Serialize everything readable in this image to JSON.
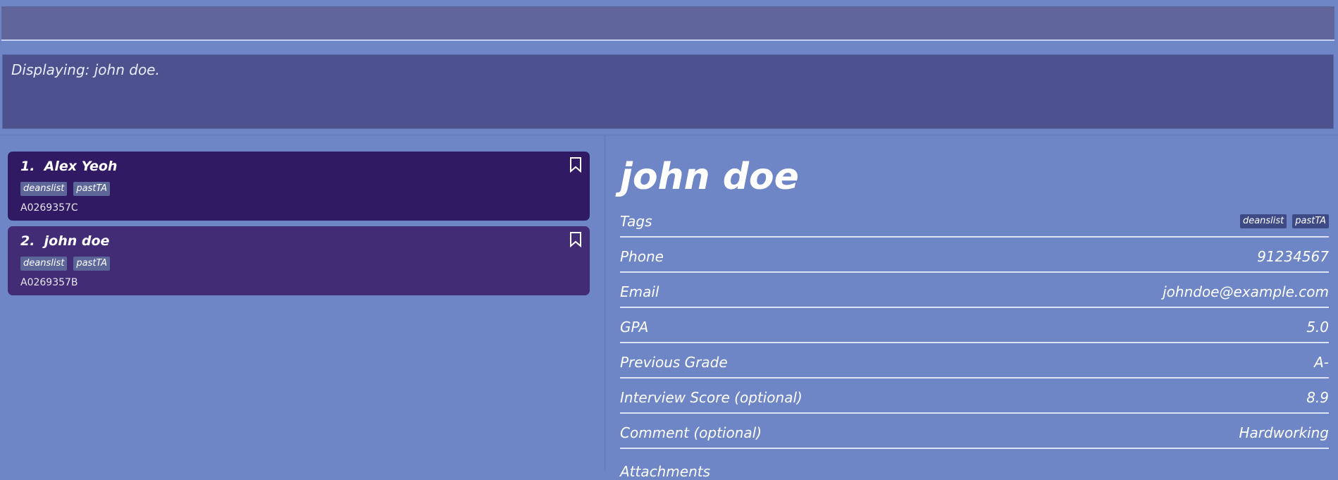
{
  "command_box": {
    "value": "",
    "placeholder": ""
  },
  "result_display": {
    "text": "Displaying: john doe."
  },
  "person_list": [
    {
      "index_name": "1.  Alex Yeoh",
      "tags": [
        "deanslist",
        "pastTA"
      ],
      "student_id": "A0269357C"
    },
    {
      "index_name": "2.  john doe",
      "tags": [
        "deanslist",
        "pastTA"
      ],
      "student_id": "A0269357B"
    }
  ],
  "detail": {
    "name": "john doe",
    "rows": {
      "tags": {
        "label": "Tags",
        "tags": [
          "deanslist",
          "pastTA"
        ]
      },
      "phone": {
        "label": "Phone",
        "value": "91234567"
      },
      "email": {
        "label": "Email",
        "value": "johndoe@example.com"
      },
      "gpa": {
        "label": "GPA",
        "value": "5.0"
      },
      "previous_grade": {
        "label": "Previous Grade",
        "value": "A-"
      },
      "interview_score": {
        "label": "Interview Score (optional)",
        "value": "8.9"
      },
      "comment": {
        "label": "Comment (optional)",
        "value": "Hardworking"
      },
      "attachments": {
        "label": "Attachments"
      }
    }
  },
  "colors": {
    "background": "#6f86c6",
    "command_box": "#60659a",
    "result_box": "#4d528f",
    "card_selected": "#301a64",
    "card_default": "#422c76"
  },
  "icons": {
    "bookmark": "bookmark-icon"
  }
}
